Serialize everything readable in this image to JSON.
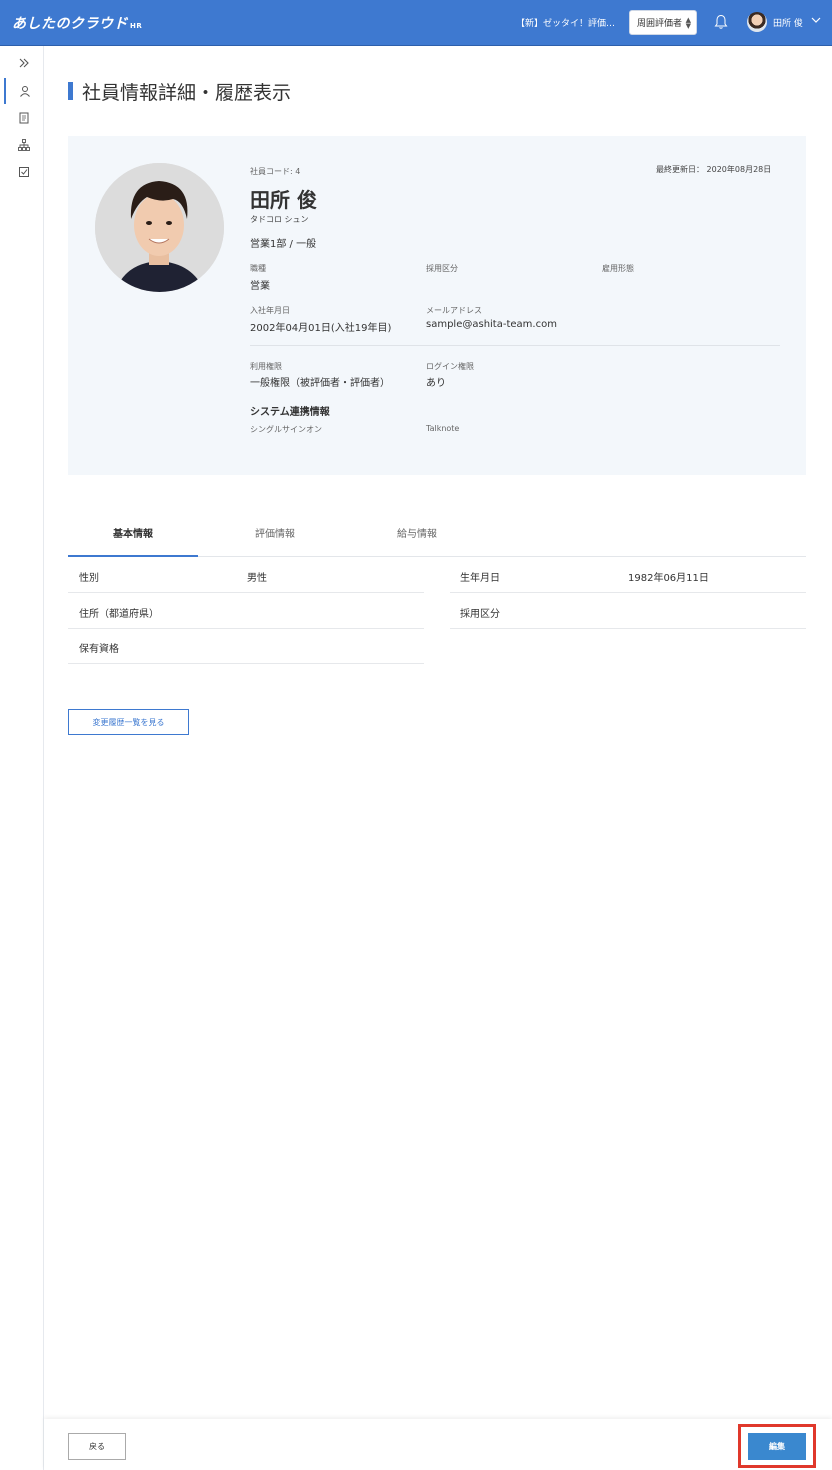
{
  "header": {
    "logo": "あしたのクラウド",
    "logo_sub": "HR",
    "notice": "【新】ゼッタイ！評価…",
    "role_select": "周囲評価者",
    "user_name": "田所 俊"
  },
  "page_title": "社員情報詳細・履歴表示",
  "profile": {
    "code_label": "社員コード: 4",
    "updated": "最終更新日： 2020年08月28日",
    "name": "田所 俊",
    "kana": "タドコロ シュン",
    "dept": "営業1部 / 一般",
    "job_label": "職種",
    "job_value": "営業",
    "hire_type_label": "採用区分",
    "employ_type_label": "雇用形態",
    "join_label": "入社年月日",
    "join_value": "2002年04月01日(入社19年目)",
    "email_label": "メールアドレス",
    "email_value": "sample@ashita-team.com",
    "perm_label": "利用権限",
    "perm_value": "一般権限（被評価者・評価者）",
    "login_label": "ログイン権限",
    "login_value": "あり",
    "sys_title": "システム連携情報",
    "sso_label": "シングルサインオン",
    "talknote_label": "Talknote"
  },
  "tabs": [
    "基本情報",
    "評価情報",
    "給与情報"
  ],
  "basic": {
    "gender_label": "性別",
    "gender_value": "男性",
    "address_label": "住所（都道府県）",
    "license_label": "保有資格",
    "birth_label": "生年月日",
    "birth_value": "1982年06月11日",
    "hire_label": "採用区分"
  },
  "history_button": "変更履歴一覧を見る",
  "footer": {
    "back": "戻る",
    "edit": "編集"
  }
}
